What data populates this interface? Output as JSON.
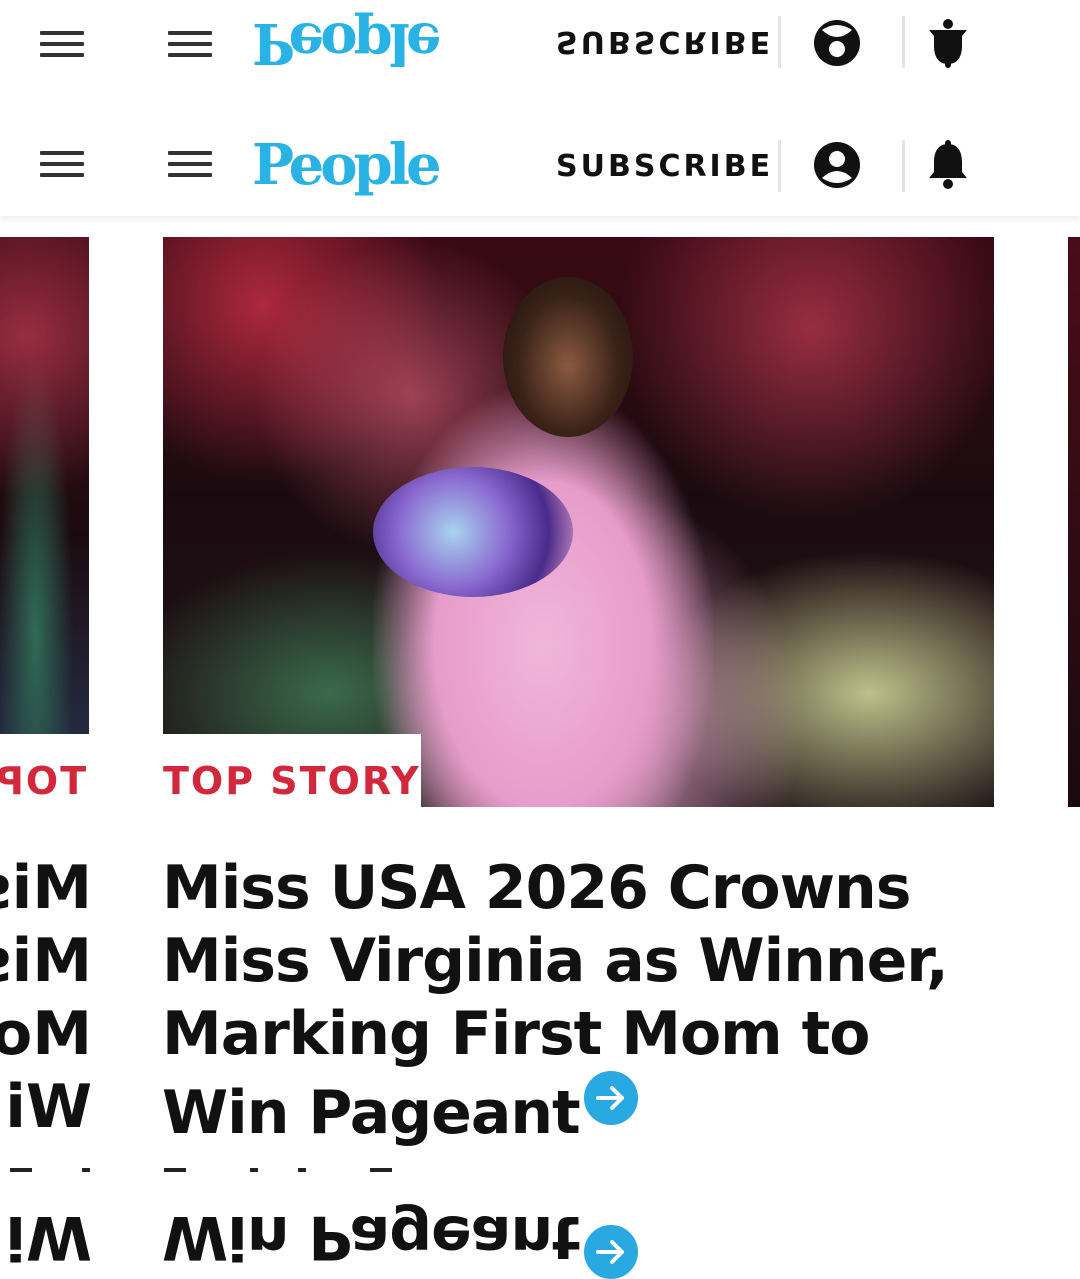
{
  "header": {
    "logo": "People",
    "subscribe_label": "SUBSCRIBE",
    "brand_color": "#29b3e4"
  },
  "story": {
    "label": "TOP STORY",
    "headline": "Miss USA 2026 Crowns Miss Virginia as Winner, Marking First Mom to Win Pageant",
    "accent_color": "#d3273c"
  },
  "adjacent_story": {
    "label_fragment": "TOP",
    "headline_lines": [
      "Miss",
      "Miss",
      "Mo",
      "Wi"
    ]
  },
  "mirror_reflection": {
    "headline_last_line": "Win Pageant",
    "left_fragment": "Wi"
  },
  "icons": {
    "menu": "hamburger-icon",
    "account": "account-icon",
    "notifications": "bell-icon",
    "read_more": "arrow-right-circle-icon"
  }
}
